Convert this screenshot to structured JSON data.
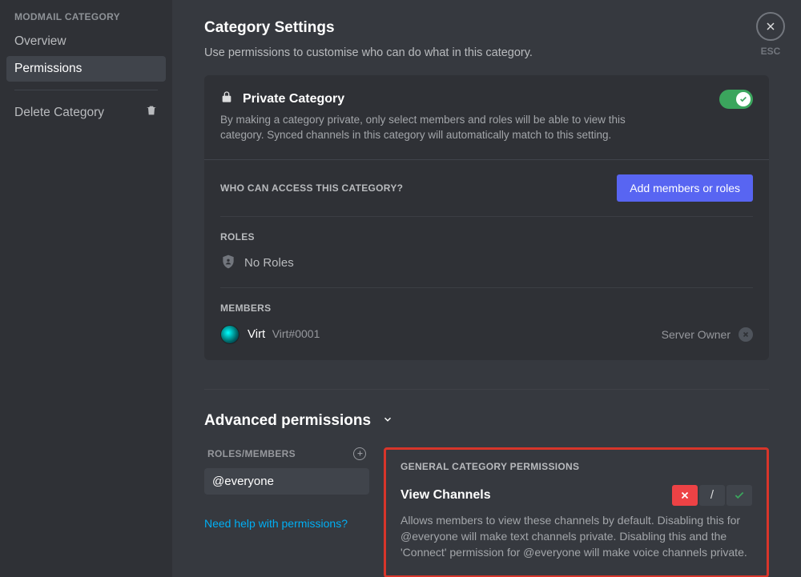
{
  "sidebar": {
    "header": "MODMAIL CATEGORY",
    "items": [
      {
        "label": "Overview"
      },
      {
        "label": "Permissions"
      },
      {
        "label": "Delete Category"
      }
    ]
  },
  "close_label": "ESC",
  "title": "Category Settings",
  "subtitle": "Use permissions to customise who can do what in this category.",
  "private": {
    "title": "Private Category",
    "desc": "By making a category private, only select members and roles will be able to view this category. Synced channels in this category will automatically match to this setting."
  },
  "access": {
    "label": "WHO CAN ACCESS THIS CATEGORY?",
    "button": "Add members or roles"
  },
  "roles": {
    "label": "ROLES",
    "empty": "No Roles"
  },
  "members": {
    "label": "MEMBERS",
    "list": [
      {
        "name": "Virt",
        "tag": "Virt#0001",
        "badge": "Server Owner"
      }
    ]
  },
  "advanced": {
    "title": "Advanced permissions",
    "roles_members_label": "ROLES/MEMBERS",
    "selected": "@everyone",
    "help_link": "Need help with permissions?",
    "group_label": "GENERAL CATEGORY PERMISSIONS",
    "perm": {
      "name": "View Channels",
      "neutral": "/",
      "desc": "Allows members to view these channels by default. Disabling this for @everyone will make text channels private. Disabling this and the 'Connect' permission for @everyone will make voice channels private."
    }
  }
}
